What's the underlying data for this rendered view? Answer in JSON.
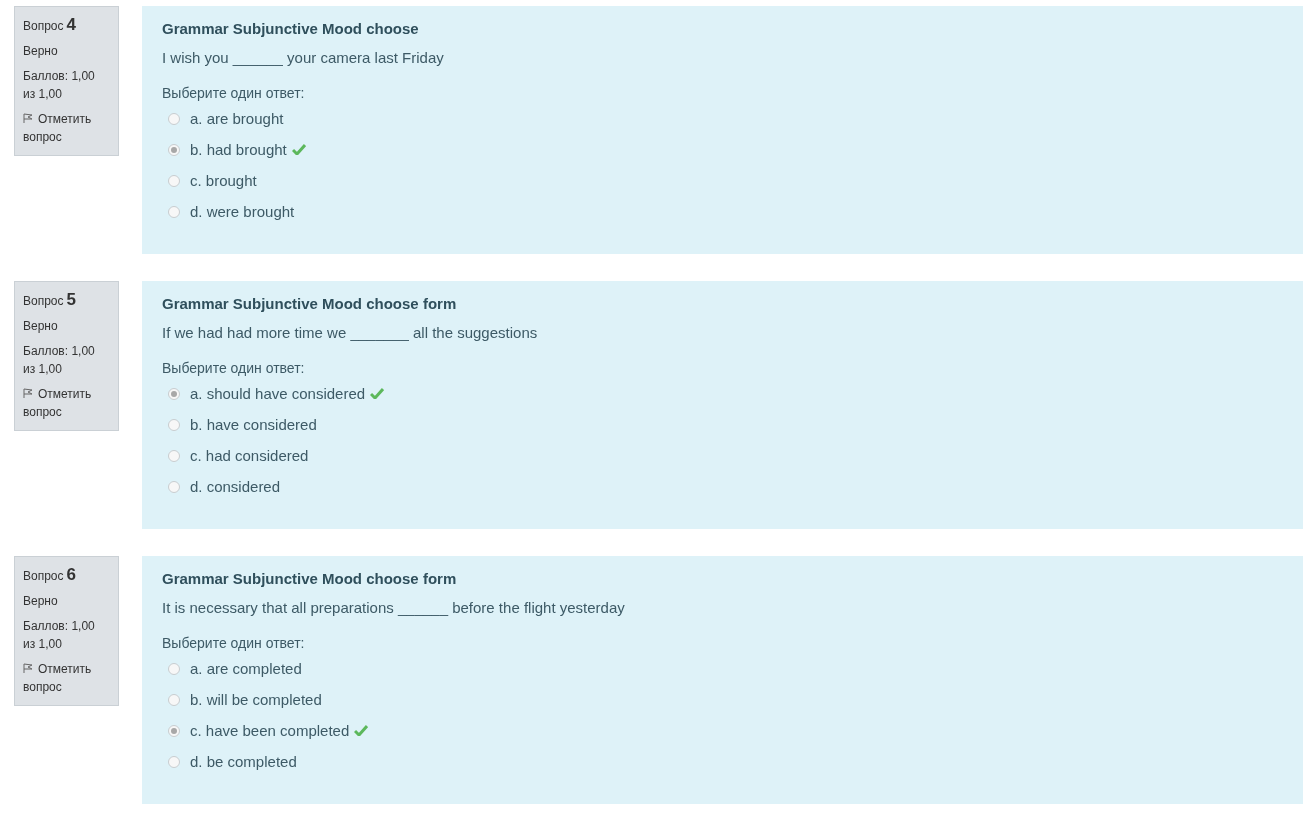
{
  "questions": [
    {
      "label": "Вопрос",
      "number": "4",
      "status": "Верно",
      "score": "Баллов: 1,00 из 1,00",
      "flag": "Отметить вопрос",
      "title": "Grammar Subjunctive Mood choose",
      "text": "I wish you ______ your camera last Friday",
      "prompt": "Выберите один ответ:",
      "options": [
        {
          "label": "a. are brought",
          "selected": false,
          "correct": false
        },
        {
          "label": "b. had brought",
          "selected": true,
          "correct": true
        },
        {
          "label": "c. brought",
          "selected": false,
          "correct": false
        },
        {
          "label": "d. were brought",
          "selected": false,
          "correct": false
        }
      ]
    },
    {
      "label": "Вопрос",
      "number": "5",
      "status": "Верно",
      "score": "Баллов: 1,00 из 1,00",
      "flag": "Отметить вопрос",
      "title": "Grammar Subjunctive Mood choose form",
      "text": "If we had had more time we _______ all the suggestions",
      "prompt": "Выберите один ответ:",
      "options": [
        {
          "label": "a. should have considered",
          "selected": true,
          "correct": true
        },
        {
          "label": "b. have considered",
          "selected": false,
          "correct": false
        },
        {
          "label": "c. had considered",
          "selected": false,
          "correct": false
        },
        {
          "label": "d. considered",
          "selected": false,
          "correct": false
        }
      ]
    },
    {
      "label": "Вопрос",
      "number": "6",
      "status": "Верно",
      "score": "Баллов: 1,00 из 1,00",
      "flag": "Отметить вопрос",
      "title": "Grammar Subjunctive Mood choose form",
      "text": "It is necessary that all preparations ______ before the flight yesterday",
      "prompt": "Выберите один ответ:",
      "options": [
        {
          "label": "a. are completed",
          "selected": false,
          "correct": false
        },
        {
          "label": "b. will be completed",
          "selected": false,
          "correct": false
        },
        {
          "label": "c. have been completed",
          "selected": true,
          "correct": true
        },
        {
          "label": "d. be completed",
          "selected": false,
          "correct": false
        }
      ]
    }
  ]
}
